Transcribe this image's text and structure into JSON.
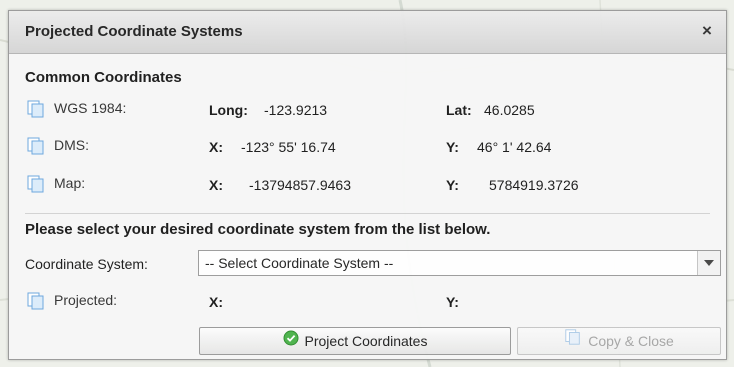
{
  "dialog": {
    "title": "Projected Coordinate Systems",
    "close_glyph": "×"
  },
  "common": {
    "heading": "Common Coordinates",
    "rows": [
      {
        "icon": "copy-icon",
        "label": "WGS 1984:",
        "k1": "Long:",
        "v1": "-123.9213",
        "k2": "Lat:",
        "v2": "46.0285"
      },
      {
        "icon": "copy-icon",
        "label": "DMS:",
        "k1": "X:",
        "v1": "-123° 55' 16.74",
        "k2": "Y:",
        "v2": "46° 1' 42.64"
      },
      {
        "icon": "copy-icon",
        "label": "Map:",
        "k1": "X:",
        "v1": "-13794857.9463",
        "k2": "Y:",
        "v2": "5784919.3726"
      }
    ]
  },
  "instruction": "Please select your desired coordinate system from the list below.",
  "coordinate_system": {
    "label": "Coordinate System:",
    "selected": "-- Select Coordinate System --"
  },
  "projected": {
    "icon": "copy-icon",
    "label": "Projected:",
    "x_label": "X:",
    "y_label": "Y:"
  },
  "buttons": {
    "project": {
      "label": "Project Coordinates",
      "icon": "check-circle-icon"
    },
    "copy_close": {
      "label": "Copy & Close",
      "icon": "copy-icon",
      "disabled": true
    }
  },
  "colors": {
    "check_green": "#4bb34b",
    "icon_blue": "#6aa6de"
  }
}
